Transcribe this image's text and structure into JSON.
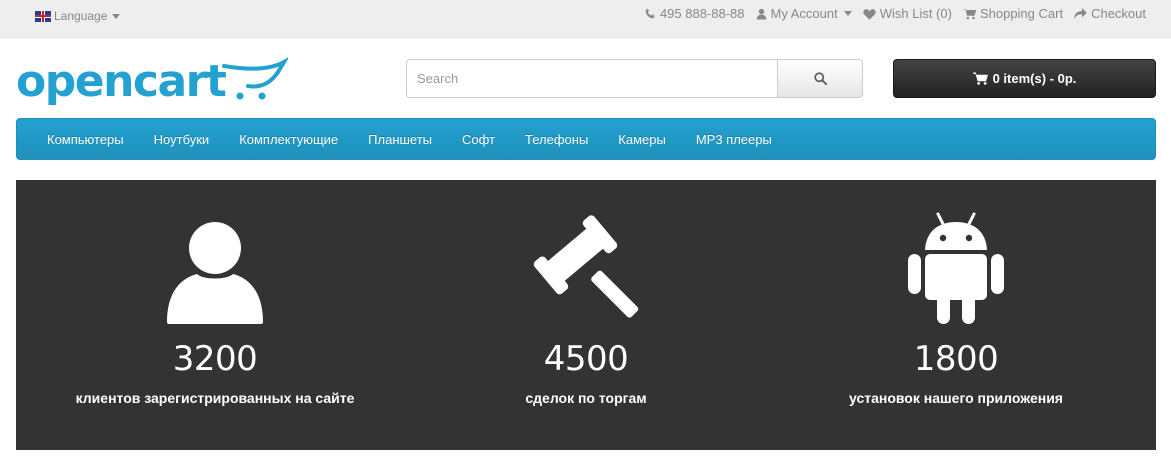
{
  "topbar": {
    "language_label": "Language",
    "phone": "495 888-88-88",
    "my_account": "My Account",
    "wish_list": "Wish List (0)",
    "shopping_cart": "Shopping Cart",
    "checkout": "Checkout"
  },
  "header": {
    "logo_text": "opencart",
    "search_placeholder": "Search",
    "cart_label": "0 item(s) - 0р."
  },
  "menu": {
    "items": [
      "Компьютеры",
      "Ноутбуки",
      "Комплектующие",
      "Планшеты",
      "Софт",
      "Телефоны",
      "Камеры",
      "MP3 плееры"
    ]
  },
  "stats": [
    {
      "icon": "user-icon",
      "value": "3200",
      "label": "клиентов зарегистрированных на сайте"
    },
    {
      "icon": "gavel-icon",
      "value": "4500",
      "label": "сделок по торгам"
    },
    {
      "icon": "android-icon",
      "value": "1800",
      "label": "установок нашего приложения"
    }
  ],
  "colors": {
    "brand": "#23a1d1",
    "stats_bg": "#333333",
    "topbar_bg": "#eeeeee",
    "cart_btn": "#303030"
  }
}
